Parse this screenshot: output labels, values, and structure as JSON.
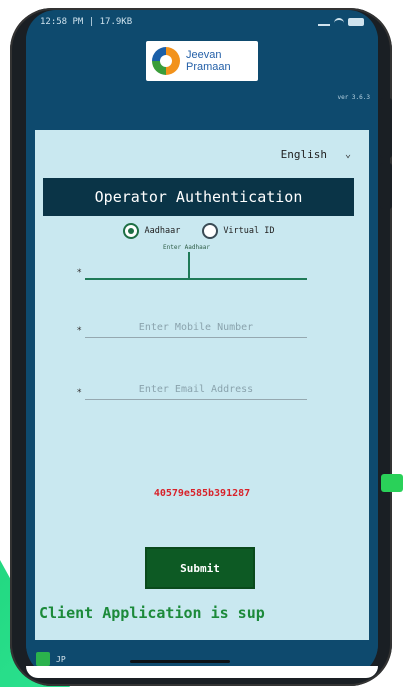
{
  "status_bar": {
    "time": "12:58",
    "info": "PM | 17.9KB",
    "icons": [
      "signal-icon",
      "wifi-icon",
      "battery-icon"
    ]
  },
  "header": {
    "logo_line1": "Jeevan",
    "logo_line2": "Pramaan",
    "version": "ver 3.6.3"
  },
  "language": {
    "selected": "English",
    "chevron": "⌄"
  },
  "title": "Operator Authentication",
  "id_type": {
    "options": [
      {
        "label": "Aadhaar",
        "selected": true
      },
      {
        "label": "Virtual ID",
        "selected": false
      }
    ]
  },
  "fields": {
    "aadhaar_label": "Enter Aadhaar",
    "aadhaar_value": "",
    "star": "*",
    "mobile_placeholder": "Enter Mobile Number",
    "email_placeholder": "Enter Email Address"
  },
  "device_hash": "40579e585b391287",
  "submit_label": "Submit",
  "marquee_text": "Client Application is sup",
  "bottom_bar": {
    "text": "JP"
  },
  "colors": {
    "app_blue": "#0e4a6e",
    "content_bg": "#c9e8f0",
    "title_bg": "#0a3447",
    "submit_bg": "#0d5a24",
    "hash_red": "#d8222a",
    "marquee_green": "#1c8a3a"
  }
}
